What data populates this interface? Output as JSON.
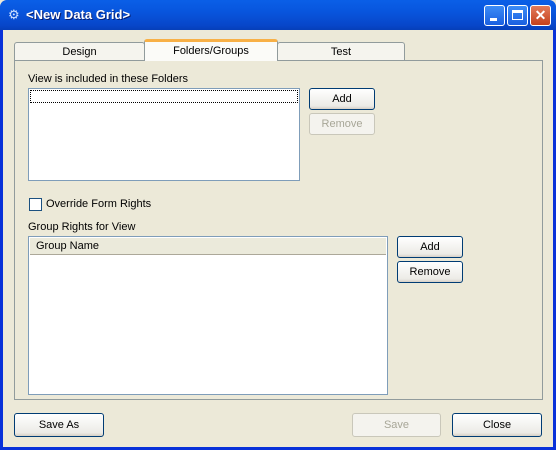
{
  "window": {
    "title": "<New Data Grid>",
    "app_icon": "data-grid-app-icon",
    "controls": {
      "minimize": "minimize-icon",
      "maximize": "maximize-icon",
      "close": "✕"
    }
  },
  "tabs": [
    {
      "label": "Design",
      "active": false
    },
    {
      "label": "Folders/Groups",
      "active": true
    },
    {
      "label": "Test",
      "active": false
    }
  ],
  "folders": {
    "label": "View is included in these Folders",
    "items": [
      ""
    ],
    "add_label": "Add",
    "remove_label": "Remove",
    "remove_disabled": true
  },
  "override": {
    "label": "Override Form Rights",
    "checked": false
  },
  "groups": {
    "label": "Group Rights for View",
    "columns": [
      "Group Name"
    ],
    "rows": [],
    "add_label": "Add",
    "remove_label": "Remove"
  },
  "footer": {
    "save_as_label": "Save As",
    "save_label": "Save",
    "save_disabled": true,
    "close_label": "Close"
  }
}
